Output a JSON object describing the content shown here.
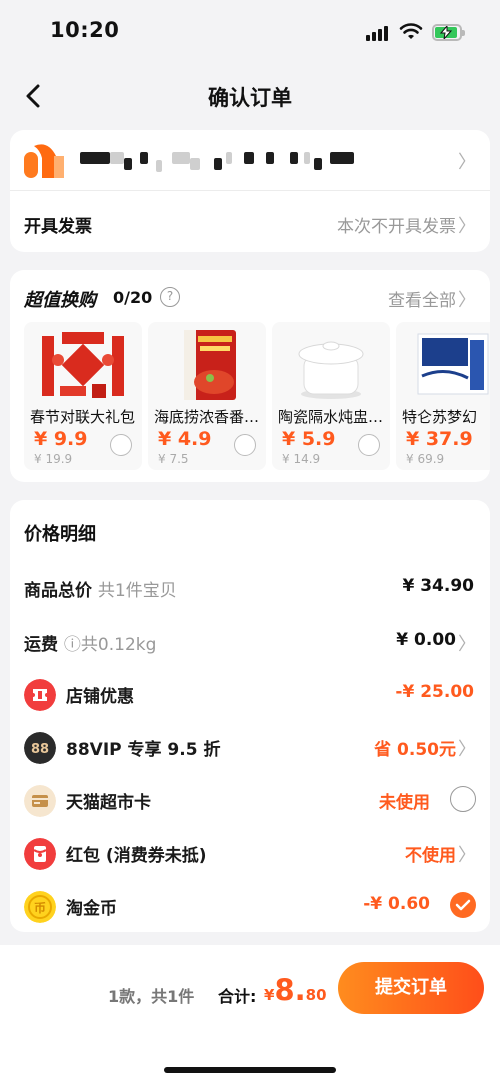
{
  "status": {
    "time": "10:20"
  },
  "nav": {
    "title": "确认订单"
  },
  "invoice": {
    "label": "开具发票",
    "value": "本次不开具发票"
  },
  "deals": {
    "title": "超值换购",
    "count": "0/20",
    "view_all": "查看全部",
    "items": [
      {
        "name": "春节对联大礼包",
        "price": "¥ 9.9",
        "orig": "¥ 19.9"
      },
      {
        "name": "海底捞浓香番…",
        "price": "¥ 4.9",
        "orig": "¥ 7.5"
      },
      {
        "name": "陶瓷隔水炖盅…",
        "price": "¥ 5.9",
        "orig": "¥ 14.9"
      },
      {
        "name": "特仑苏梦幻",
        "price": "¥ 37.9",
        "orig": "¥ 69.9"
      }
    ]
  },
  "price": {
    "heading": "价格明细",
    "goods_label": "商品总价",
    "goods_sub": "共1件宝贝",
    "goods_value": "¥ 34.90",
    "shipping_label": "运费",
    "shipping_sub": "共0.12kg",
    "shipping_value": "¥ 0.00",
    "shop_label": "店铺优惠",
    "shop_value": "-¥ 25.00",
    "vip_label": "88VIP 专享 9.5 折",
    "vip_value": "省 0.50元",
    "card_label": "天猫超市卡",
    "card_value": "未使用",
    "redpacket_label": "红包 (消费券未抵)",
    "redpacket_value": "不使用",
    "coin_label": "淘金币",
    "coin_value": "-¥ 0.60"
  },
  "footer": {
    "count": "1款，共1件",
    "total_label": "合计:",
    "currency": "¥",
    "total_int": "8.",
    "total_dec": "80",
    "submit": "提交订单"
  },
  "colors": {
    "accent": "#ff5a1e",
    "check": "#ff6a22"
  }
}
